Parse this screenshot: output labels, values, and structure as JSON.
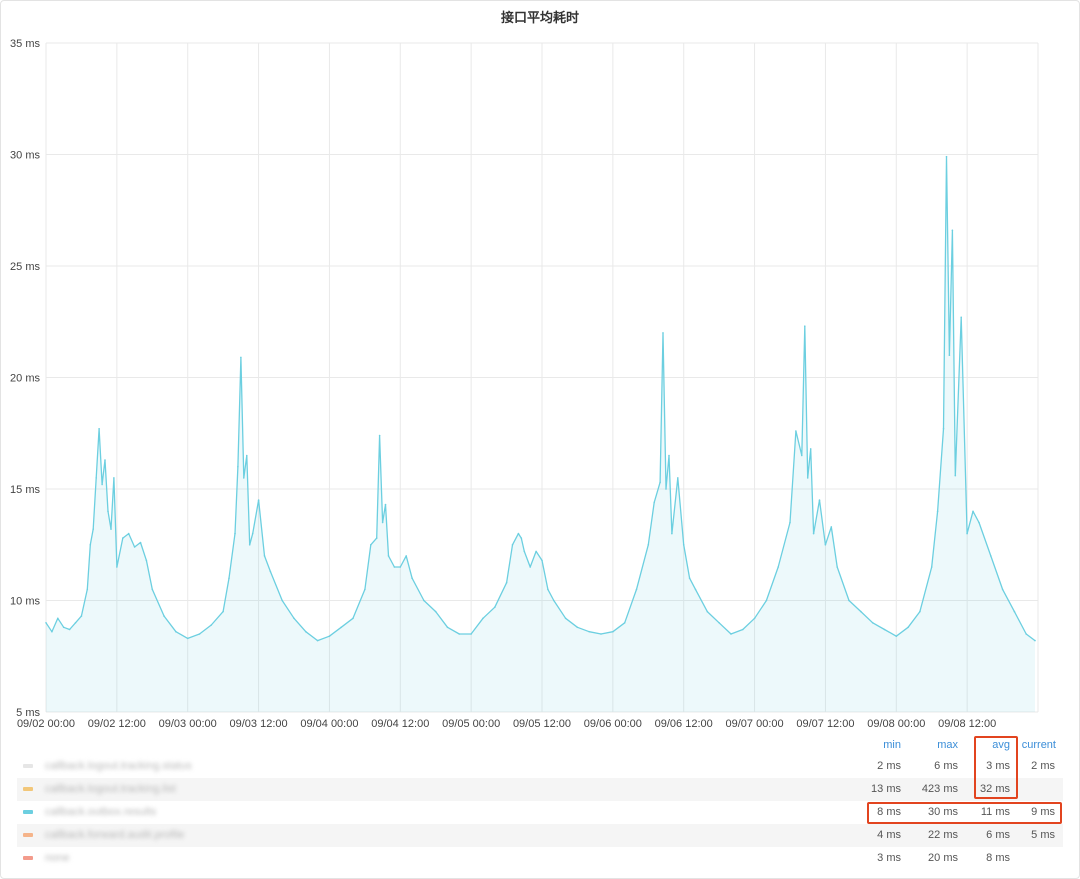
{
  "chart_data": {
    "type": "area",
    "title": "接口平均耗时",
    "xlabel": "",
    "ylabel": "",
    "ylim": [
      5,
      35
    ],
    "xlim": [
      "09/02 00:00",
      "09/08 23:59"
    ],
    "y_ticks": [
      "5 ms",
      "10 ms",
      "15 ms",
      "20 ms",
      "25 ms",
      "30 ms",
      "35 ms"
    ],
    "x_ticks": [
      "09/02 00:00",
      "09/02 12:00",
      "09/03 00:00",
      "09/03 12:00",
      "09/04 00:00",
      "09/04 12:00",
      "09/05 00:00",
      "09/05 12:00",
      "09/06 00:00",
      "09/06 12:00",
      "09/07 00:00",
      "09/07 12:00",
      "09/08 00:00",
      "09/08 12:00"
    ],
    "grid": true,
    "series": [
      {
        "color": "#6ccfe0",
        "x_hours": [
          0,
          1,
          2,
          3,
          4,
          5,
          6,
          7,
          7.5,
          8,
          8.5,
          9,
          9.5,
          10,
          10.5,
          11,
          11.5,
          12,
          13,
          14,
          15,
          16,
          17,
          18,
          20,
          22,
          24,
          26,
          28,
          30,
          31,
          32,
          32.5,
          33,
          33.5,
          34,
          34.5,
          35,
          36,
          37,
          38,
          40,
          42,
          44,
          46,
          48,
          50,
          52,
          54,
          55,
          56,
          56.5,
          57,
          57.5,
          58,
          59,
          60,
          61,
          62,
          64,
          66,
          68,
          70,
          72,
          74,
          76,
          78,
          79,
          80,
          80.5,
          81,
          82,
          83,
          84,
          85,
          86,
          88,
          90,
          92,
          94,
          96,
          98,
          100,
          102,
          103,
          104,
          104.5,
          105,
          105.5,
          106,
          107,
          108,
          109,
          110,
          112,
          114,
          116,
          118,
          120,
          122,
          124,
          126,
          127,
          128,
          128.5,
          129,
          129.5,
          130,
          131,
          132,
          133,
          134,
          136,
          138,
          140,
          142,
          144,
          146,
          148,
          150,
          151,
          152,
          152.5,
          153,
          153.5,
          154,
          155,
          156,
          157,
          158,
          160,
          162,
          164,
          166,
          167.5
        ],
        "values": [
          9,
          8.6,
          9.2,
          8.8,
          8.7,
          9,
          9.3,
          10.5,
          12.5,
          13.2,
          15.5,
          17.7,
          15.2,
          16.3,
          14,
          13.2,
          15.5,
          11.5,
          12.8,
          13,
          12.4,
          12.6,
          11.8,
          10.5,
          9.3,
          8.6,
          8.3,
          8.5,
          8.9,
          9.5,
          11,
          13,
          16,
          20.9,
          15.5,
          16.5,
          12.5,
          13,
          14.5,
          12,
          11.3,
          10,
          9.2,
          8.6,
          8.2,
          8.4,
          8.8,
          9.2,
          10.5,
          12.5,
          12.8,
          17.4,
          13.5,
          14.3,
          12,
          11.5,
          11.5,
          12,
          11,
          10,
          9.5,
          8.8,
          8.5,
          8.5,
          9.2,
          9.7,
          10.8,
          12.5,
          13,
          12.8,
          12.2,
          11.5,
          12.2,
          11.8,
          10.5,
          10,
          9.2,
          8.8,
          8.6,
          8.5,
          8.6,
          9,
          10.5,
          12.5,
          14.4,
          15.3,
          22,
          15,
          16.5,
          13,
          15.5,
          12.5,
          11,
          10.5,
          9.5,
          9,
          8.5,
          8.7,
          9.2,
          10,
          11.5,
          13.5,
          17.6,
          16.5,
          22.3,
          15.5,
          16.8,
          13,
          14.5,
          12.5,
          13.3,
          11.5,
          10,
          9.5,
          9,
          8.7,
          8.4,
          8.8,
          9.5,
          11.5,
          14,
          17.7,
          29.9,
          21,
          26.6,
          15.6,
          22.7,
          13,
          14,
          13.5,
          12,
          10.5,
          9.5,
          8.5,
          8.2
        ]
      }
    ]
  },
  "legend": {
    "headers": [
      "min",
      "max",
      "avg",
      "current"
    ],
    "rows": [
      {
        "name": "callback.logout.tracking.status",
        "color": "#e6e6e6",
        "min": "2 ms",
        "max": "6 ms",
        "avg": "3 ms",
        "current": "2 ms"
      },
      {
        "name": "callback.logout.tracking.list",
        "color": "#f2c77a",
        "min": "13 ms",
        "max": "423 ms",
        "avg": "32 ms",
        "current": ""
      },
      {
        "name": "callback.outbox.results",
        "color": "#6ccfe0",
        "min": "8 ms",
        "max": "30 ms",
        "avg": "11 ms",
        "current": "9 ms"
      },
      {
        "name": "callback.forward.audit.profile",
        "color": "#f5b48a",
        "min": "4 ms",
        "max": "22 ms",
        "avg": "6 ms",
        "current": "5 ms"
      },
      {
        "name": "none",
        "color": "#f39b8c",
        "min": "3 ms",
        "max": "20 ms",
        "avg": "8 ms",
        "current": ""
      }
    ]
  }
}
